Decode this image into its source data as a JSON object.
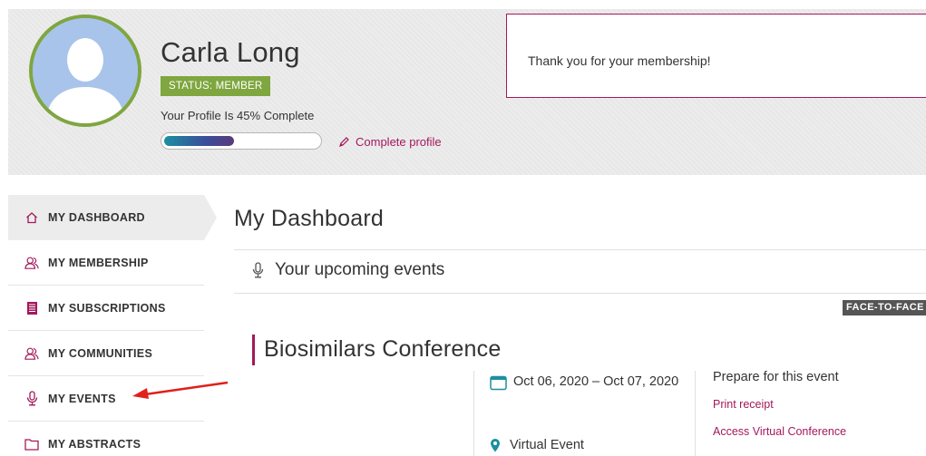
{
  "profile": {
    "name": "Carla Long",
    "status": "STATUS: MEMBER",
    "completeness_text": "Your Profile Is 45% Complete",
    "completeness_value": 0.45,
    "complete_link": "Complete profile",
    "thanks_message": "Thank you for your membership!"
  },
  "sidebar": {
    "items": [
      {
        "label": "MY DASHBOARD",
        "icon": "home-icon",
        "active": true
      },
      {
        "label": "MY MEMBERSHIP",
        "icon": "users-icon"
      },
      {
        "label": "MY SUBSCRIPTIONS",
        "icon": "document-icon"
      },
      {
        "label": "MY COMMUNITIES",
        "icon": "users-icon"
      },
      {
        "label": "MY EVENTS",
        "icon": "microphone-icon"
      },
      {
        "label": "MY ABSTRACTS",
        "icon": "folder-icon"
      }
    ]
  },
  "main": {
    "title": "My Dashboard",
    "upcoming_heading": "Your upcoming events",
    "event": {
      "type_badge": "FACE-TO-FACE",
      "title": "Biosimilars Conference",
      "dates": "Oct 06, 2020 – Oct 07, 2020",
      "location": "Virtual Event",
      "prepare_heading": "Prepare for this event",
      "links": [
        "Print receipt",
        "Access Virtual Conference"
      ]
    }
  },
  "colors": {
    "accent": "#a3195b",
    "member_green": "#7fa63f",
    "teal": "#1c8fa0",
    "arrow_red": "#e0201b"
  }
}
